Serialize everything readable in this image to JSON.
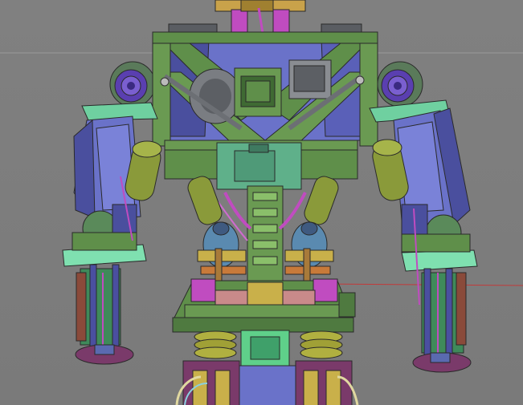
{
  "viewport": {
    "background": "#7f7f7f",
    "grid_color": "#9a9a9a",
    "axis_x_color": "#c23a3a"
  },
  "model": {
    "palette": {
      "torso_green": "#5f8f4a",
      "torso_green_dark": "#3f6a33",
      "panel_teal": "#5fb08a",
      "arm_blue": "#6a72c9",
      "arm_blue_dark": "#4a4f9e",
      "mint_plate": "#7fe0b0",
      "piston_olive": "#8a9a3a",
      "engine_gray": "#7a7d82",
      "sphere_purple": "#5a3fb0",
      "magenta_pipe": "#c04cc0",
      "orange_clamp": "#c87a3a",
      "tan_block": "#c9b04a",
      "pink_block": "#c98a8a",
      "maroon_base": "#7a3a6a",
      "brown_post": "#8a4a3a",
      "cream_cable": "#e0d8a0"
    }
  }
}
